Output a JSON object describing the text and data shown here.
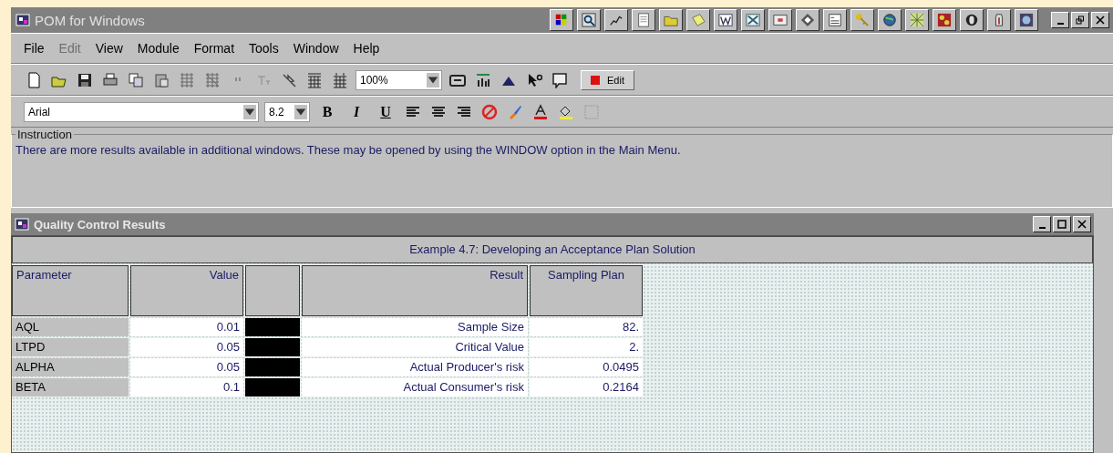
{
  "window": {
    "title": "POM for Windows"
  },
  "menu": [
    {
      "label": "File",
      "disabled": false
    },
    {
      "label": "Edit",
      "disabled": true
    },
    {
      "label": "View",
      "disabled": false
    },
    {
      "label": "Module",
      "disabled": false
    },
    {
      "label": "Format",
      "disabled": false
    },
    {
      "label": "Tools",
      "disabled": false
    },
    {
      "label": "Window",
      "disabled": false
    },
    {
      "label": "Help",
      "disabled": false
    }
  ],
  "toolbar": {
    "zoom": "100%",
    "edit_button": "Edit"
  },
  "format_bar": {
    "font": "Arial",
    "size": "8.2",
    "style_buttons": [
      "B",
      "I",
      "U"
    ]
  },
  "instruction": {
    "legend": "Instruction",
    "text": "There are more results available in additional windows. These may be opened by using the WINDOW option in the Main Menu."
  },
  "child_window": {
    "title": "Quality Control Results",
    "caption": "Example 4.7: Developing an Acceptance Plan Solution",
    "columns": [
      "Parameter",
      "Value",
      "",
      "Result",
      "Sampling Plan"
    ],
    "rows": [
      [
        "AQL",
        "0.01",
        "",
        "Sample Size",
        "82."
      ],
      [
        "LTPD",
        "0.05",
        "",
        "Critical Value",
        "2."
      ],
      [
        "ALPHA",
        "0.05",
        "",
        "Actual Producer's risk",
        "0.0495"
      ],
      [
        "BETA",
        "0.1",
        "",
        "Actual Consumer's risk",
        "0.2164"
      ]
    ]
  }
}
